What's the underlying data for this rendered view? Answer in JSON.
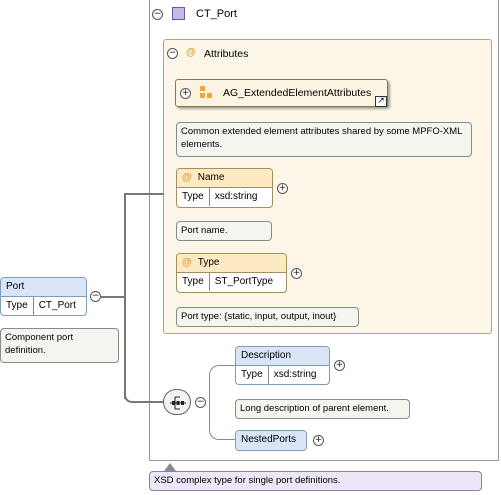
{
  "complex_type": {
    "name": "CT_Port",
    "description": "XSD complex type for single port definitions."
  },
  "attributes_group": {
    "label": "Attributes",
    "ref_group": {
      "name": "AG_ExtendedElementAttributes",
      "description": "Common extended element attributes shared by some MPFO-XML elements."
    },
    "items": [
      {
        "name": "Name",
        "type_key": "Type",
        "type_value": "xsd:string",
        "description": "Port name."
      },
      {
        "name": "Type",
        "type_key": "Type",
        "type_value": "ST_PortType",
        "description": "Port type: {static, input, output, inout}"
      }
    ]
  },
  "port_element": {
    "name": "Port",
    "type_key": "Type",
    "type_value": "CT_Port",
    "description": "Component port definition."
  },
  "sequence_children": [
    {
      "name": "Description",
      "type_key": "Type",
      "type_value": "xsd:string",
      "description": "Long description of parent element."
    },
    {
      "name": "NestedPorts"
    }
  ],
  "symbols": {
    "collapse": "−",
    "expand": "+",
    "attribute_marker": "@",
    "link_arrow": "↗"
  },
  "colors": {
    "element_header": "#d9e5f7",
    "attribute_header": "#fde9c2",
    "complex_type_icon": "#c8b8e6",
    "note_background": "#f5f5f0",
    "type_description_background": "#ece6f7",
    "group_icon": "#f0a83c"
  }
}
